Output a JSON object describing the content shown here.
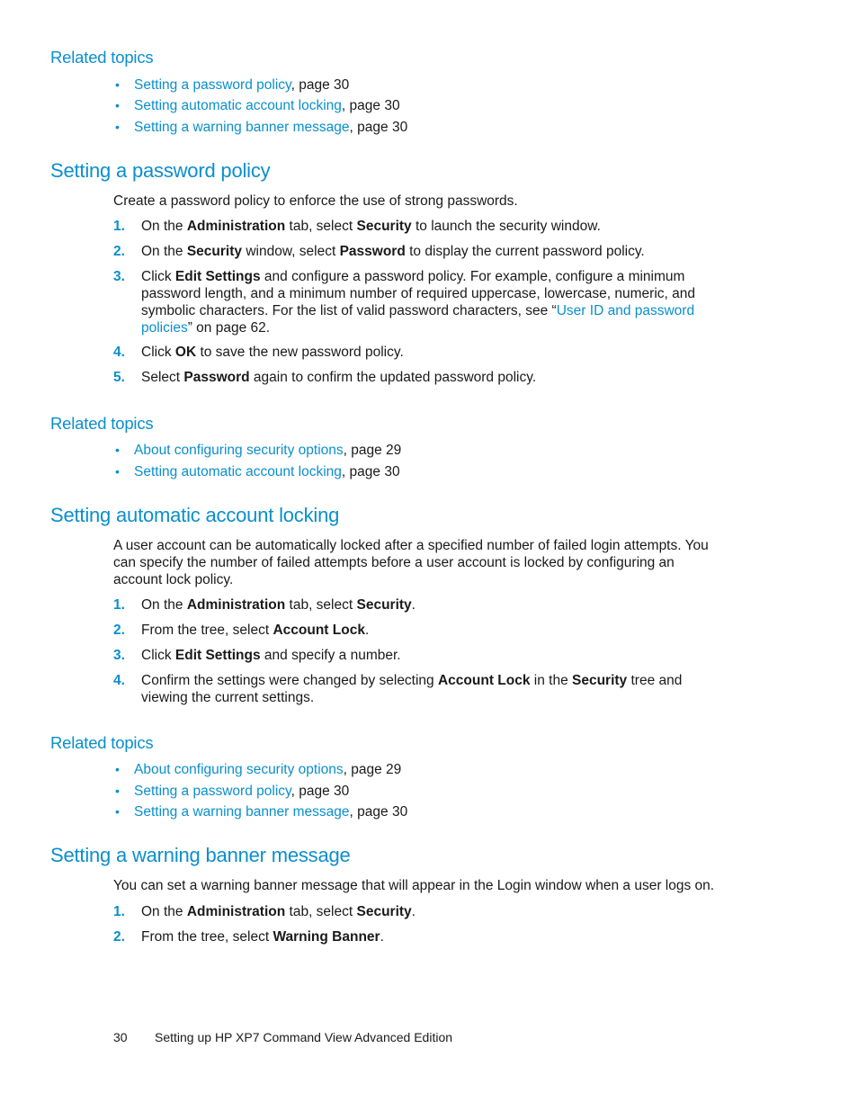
{
  "colors": {
    "accent": "#0a8fcc",
    "text": "#1a1a1a"
  },
  "related_1": {
    "heading": "Related topics",
    "items": [
      {
        "link": "Setting a password policy",
        "suffix": ", page 30"
      },
      {
        "link": "Setting automatic account locking",
        "suffix": ", page 30"
      },
      {
        "link": "Setting a warning banner message",
        "suffix": ", page 30"
      }
    ]
  },
  "password_policy": {
    "title": "Setting a password policy",
    "intro": "Create a password policy to enforce the use of strong passwords.",
    "steps": [
      {
        "num": "1.",
        "parts": [
          "On the ",
          "Administration",
          " tab, select ",
          "Security",
          " to launch the security window."
        ]
      },
      {
        "num": "2.",
        "parts": [
          "On the ",
          "Security",
          " window, select ",
          "Password",
          " to display the current password policy."
        ]
      },
      {
        "num": "3.",
        "parts": [
          "Click ",
          "Edit Settings",
          " and configure a password policy. For example, configure a minimum password length, and a minimum number of required uppercase, lowercase, numeric, and symbolic characters. For the list of valid password characters, see “"
        ],
        "link": "User ID and password policies",
        "after_link": "” on page 62."
      },
      {
        "num": "4.",
        "parts": [
          "Click ",
          "OK",
          " to save the new password policy."
        ]
      },
      {
        "num": "5.",
        "parts": [
          "Select ",
          "Password",
          " again to confirm the updated password policy."
        ]
      }
    ]
  },
  "related_2": {
    "heading": "Related topics",
    "items": [
      {
        "link": "About configuring security options",
        "suffix": ", page 29"
      },
      {
        "link": "Setting automatic account locking",
        "suffix": ", page 30"
      }
    ]
  },
  "account_locking": {
    "title": "Setting automatic account locking",
    "intro": "A user account can be automatically locked after a specified number of failed login attempts. You can specify the number of failed attempts before a user account is locked by configuring an account lock policy.",
    "steps": [
      {
        "num": "1.",
        "parts": [
          "On the ",
          "Administration",
          " tab, select ",
          "Security",
          "."
        ]
      },
      {
        "num": "2.",
        "parts": [
          "From the tree, select ",
          "Account Lock",
          "."
        ]
      },
      {
        "num": "3.",
        "parts": [
          "Click ",
          "Edit Settings",
          " and specify a number."
        ]
      },
      {
        "num": "4.",
        "parts": [
          "Confirm the settings were changed by selecting ",
          "Account Lock",
          " in the ",
          "Security",
          " tree and viewing the current settings."
        ]
      }
    ]
  },
  "related_3": {
    "heading": "Related topics",
    "items": [
      {
        "link": "About configuring security options",
        "suffix": ", page 29"
      },
      {
        "link": "Setting a password policy",
        "suffix": ", page 30"
      },
      {
        "link": "Setting a warning banner message",
        "suffix": ", page 30"
      }
    ]
  },
  "warning_banner": {
    "title": "Setting a warning banner message",
    "intro": "You can set a warning banner message that will appear in the Login window when a user logs on.",
    "steps": [
      {
        "num": "1.",
        "parts": [
          "On the ",
          "Administration",
          " tab, select ",
          "Security",
          "."
        ]
      },
      {
        "num": "2.",
        "parts": [
          "From the tree, select ",
          "Warning Banner",
          "."
        ]
      }
    ]
  },
  "footer": {
    "page_number": "30",
    "title": "Setting up HP XP7 Command View Advanced Edition"
  },
  "bullet_glyph": "•"
}
